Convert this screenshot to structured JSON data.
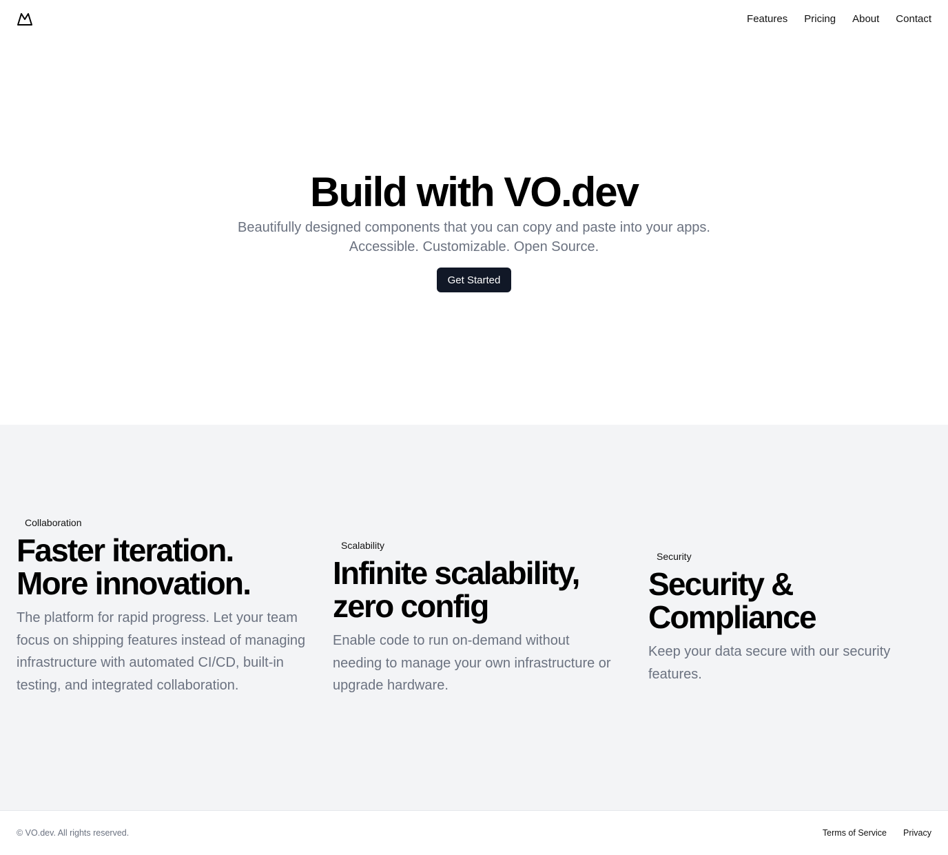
{
  "header": {
    "logo_icon": "mountain-icon",
    "nav": [
      {
        "label": "Features"
      },
      {
        "label": "Pricing"
      },
      {
        "label": "About"
      },
      {
        "label": "Contact"
      }
    ]
  },
  "hero": {
    "title": "Build with VO.dev",
    "subtitle": "Beautifully designed components that you can copy and paste into your apps. Accessible. Customizable. Open Source.",
    "cta_label": "Get Started"
  },
  "features": [
    {
      "tag": "Collaboration",
      "title_line1": "Faster iteration.",
      "title_line2": "More innovation.",
      "description": "The platform for rapid progress. Let your team focus on shipping features instead of managing infrastructure with automated CI/CD, built-in testing, and integrated collaboration."
    },
    {
      "tag": "Scalability",
      "title_line1": "Infinite scalability,",
      "title_line2": "zero config",
      "description": "Enable code to run on-demand without needing to manage your own infrastructure or upgrade hardware."
    },
    {
      "tag": "Security",
      "title_line1": "Security &",
      "title_line2": "Compliance",
      "description": "Keep your data secure with our security features."
    }
  ],
  "footer": {
    "copyright": "© VO.dev. All rights reserved.",
    "links": [
      {
        "label": "Terms of Service"
      },
      {
        "label": "Privacy"
      }
    ]
  },
  "colors": {
    "cta_background": "#111827",
    "feature_section_background": "#f3f4f6",
    "muted_text": "#6b7280"
  }
}
